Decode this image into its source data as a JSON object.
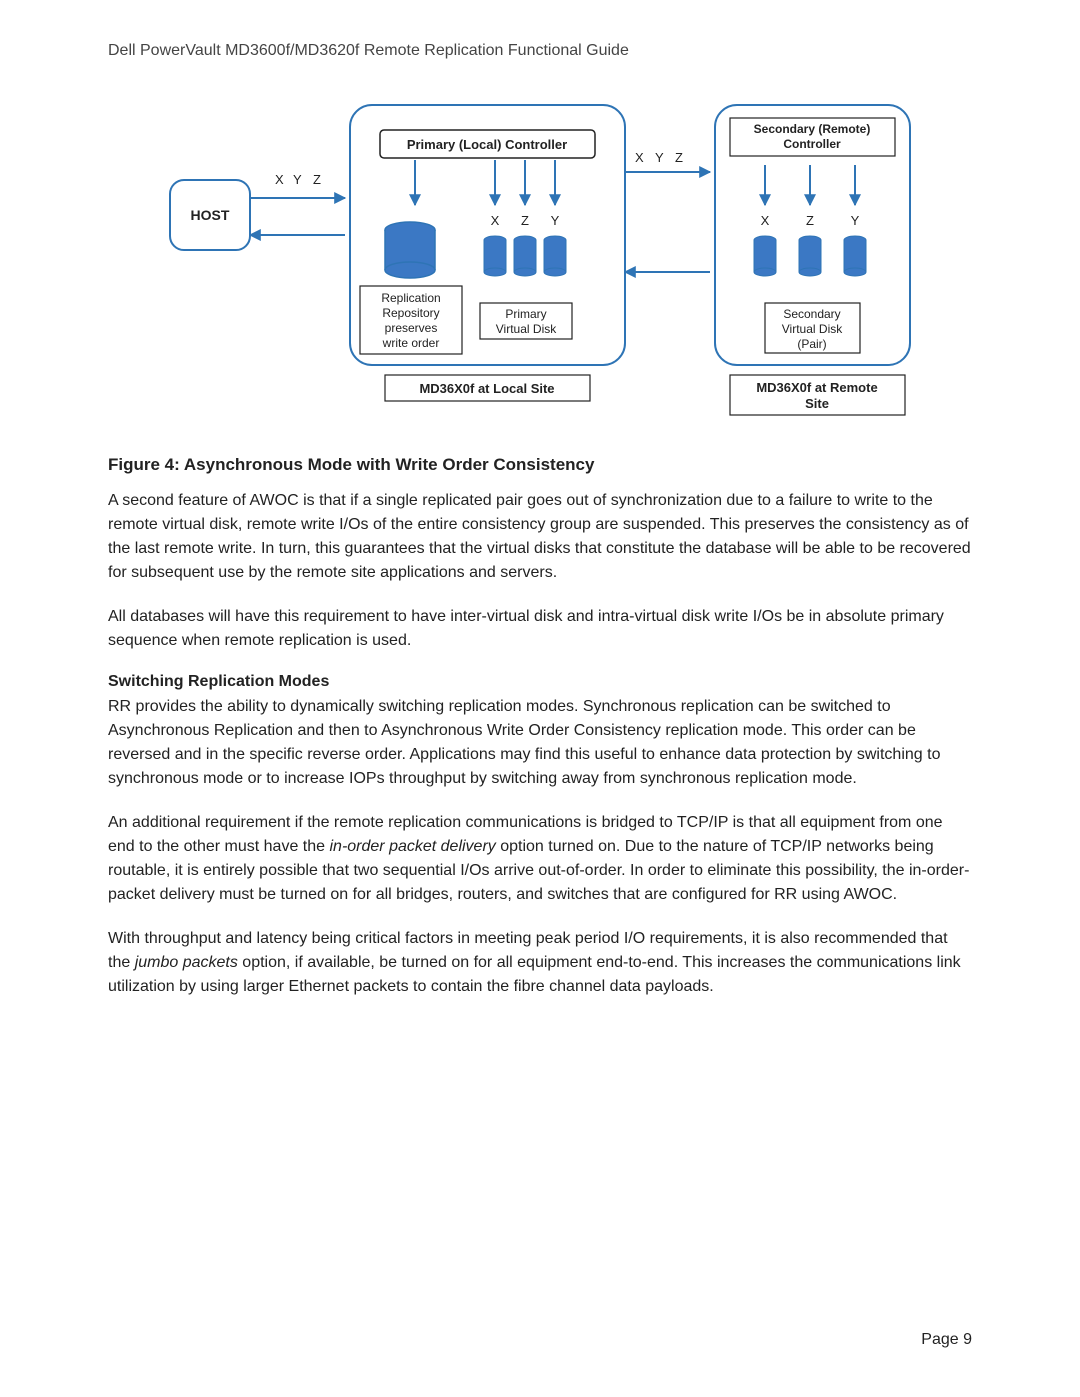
{
  "doc_title": "Dell PowerVault MD3600f/MD3620f Remote Replication Functional Guide",
  "figure": {
    "caption": "Figure 4: Asynchronous Mode with Write Order Consistency",
    "host_label": "HOST",
    "host_xyz": [
      "X",
      "Y",
      "Z"
    ],
    "primary_controller_label": "Primary (Local) Controller",
    "repo_label_lines": [
      "Replication",
      "Repository",
      "preserves",
      "write order"
    ],
    "primary_vd_label_lines": [
      "Primary",
      "Virtual Disk"
    ],
    "primary_xyz": [
      "X",
      "Z",
      "Y"
    ],
    "local_site_label": "MD36X0f at Local Site",
    "link_xyz": [
      "X",
      "Y",
      "Z"
    ],
    "secondary_controller_label_lines": [
      "Secondary (Remote)",
      "Controller"
    ],
    "secondary_xyz": [
      "X",
      "Z",
      "Y"
    ],
    "secondary_vd_label_lines": [
      "Secondary",
      "Virtual Disk",
      "(Pair)"
    ],
    "remote_site_label_lines": [
      "MD36X0f at Remote",
      "Site"
    ]
  },
  "paragraphs": {
    "p1": "A second feature of AWOC is that if a single replicated pair goes out of synchronization due to a failure to write to the remote virtual disk, remote write I/Os of the entire consistency group are suspended. This preserves the consistency as of the last remote write. In turn, this guarantees that the virtual disks that constitute the database will be able to be recovered for subsequent use by the remote site applications and servers.",
    "p2": "All databases will have this requirement to have inter-virtual disk and intra-virtual disk write I/Os be in absolute primary sequence when remote replication is used.",
    "subhead1": "Switching Replication Modes",
    "p3": "RR provides the ability to dynamically switching replication modes. Synchronous replication can be switched to Asynchronous Replication and then to Asynchronous Write Order Consistency replication mode. This order can be reversed and in the specific reverse order. Applications may find this useful to enhance data protection by switching to synchronous mode or to increase IOPs throughput by switching away from synchronous replication mode.",
    "p4_a": "An additional requirement if the remote replication communications is bridged to TCP/IP is that all equipment from one end to the other must have the ",
    "p4_term1": "in-order packet delivery",
    "p4_b": " option turned on. Due to the nature of TCP/IP networks being routable, it is entirely possible that two sequential I/Os arrive out-of-order. In order to eliminate this possibility, the in-order-packet delivery must be turned on for all bridges, routers, and switches that are configured for RR using AWOC.",
    "p5_a": "With throughput and latency being critical factors in meeting peak period I/O requirements, it is also recommended that the ",
    "p5_term1": "jumbo packets",
    "p5_b": " option, if available, be turned on for all equipment end-to-end. This increases the communications link utilization by using larger Ethernet packets to contain the fibre channel data payloads."
  },
  "page_number": "Page 9",
  "diagram_colors": {
    "outline": "#2e74b5",
    "fill": "#3b78c4",
    "text": "#222222"
  }
}
